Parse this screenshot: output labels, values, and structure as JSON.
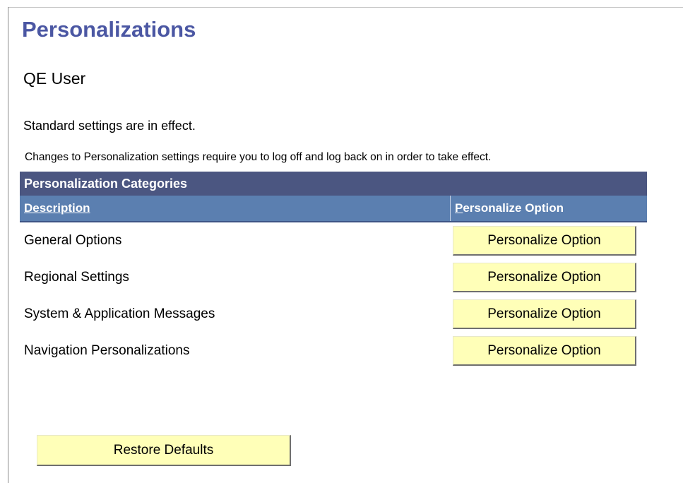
{
  "page": {
    "title": "Personalizations",
    "user": "QE User",
    "status": "Standard settings are in effect.",
    "notice": "Changes to Personalization settings require you to log off and log back on in order to take effect."
  },
  "grid": {
    "title": "Personalization Categories",
    "columns": {
      "description": "Description",
      "option_accesskey": "P",
      "option_rest": "ersonalize Option"
    },
    "rows": [
      {
        "description": "General Options",
        "button": "Personalize Option"
      },
      {
        "description": "Regional Settings",
        "button": "Personalize Option"
      },
      {
        "description": "System & Application Messages",
        "button": "Personalize Option"
      },
      {
        "description": "Navigation Personalizations",
        "button": "Personalize Option"
      }
    ]
  },
  "actions": {
    "restore_label": "Restore Defaults"
  },
  "colors": {
    "title": "#4b57a3",
    "grid_header": "#4b5681",
    "column_header": "#5b7fb0",
    "button": "#ffffb8"
  }
}
